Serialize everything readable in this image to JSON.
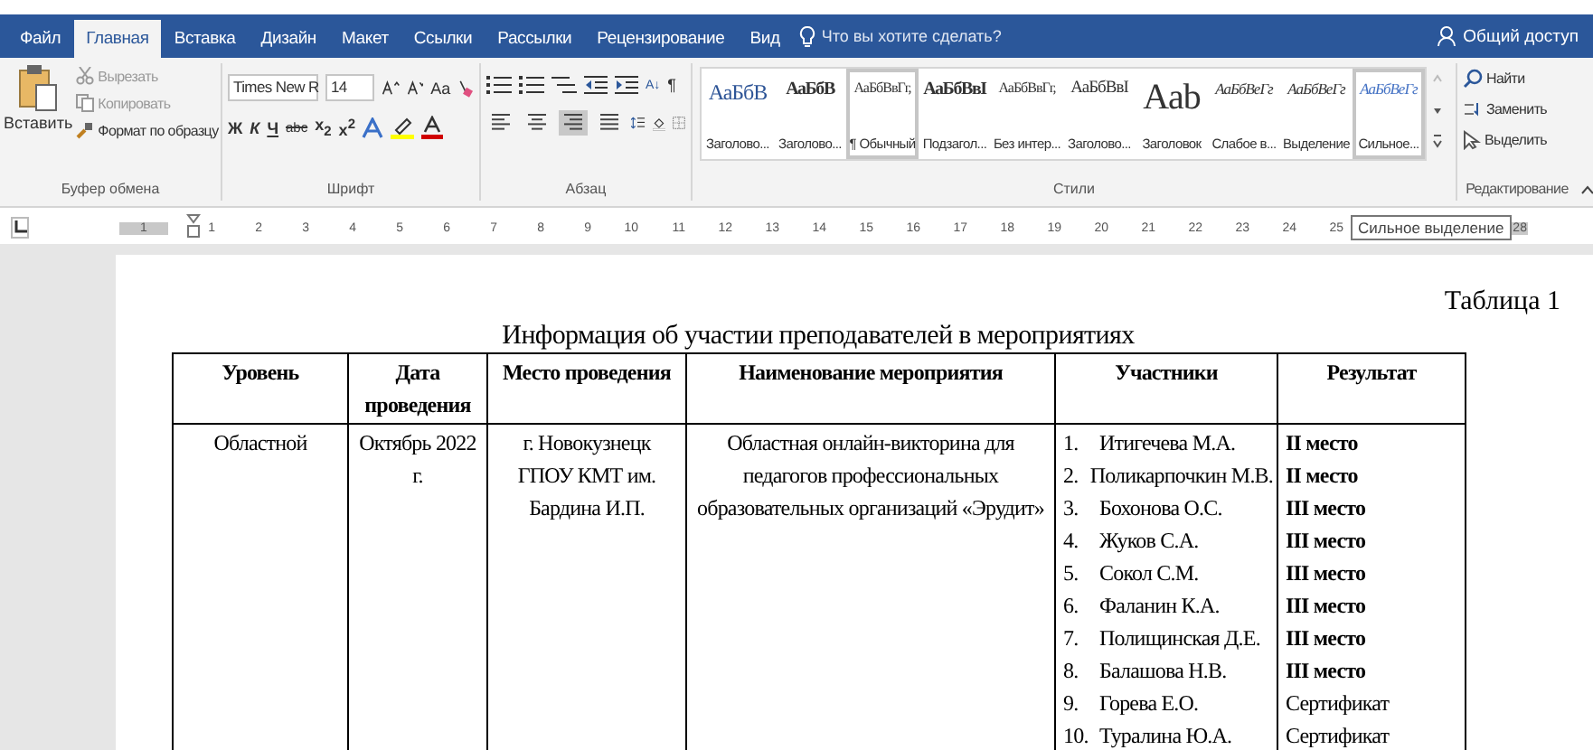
{
  "tabs": [
    {
      "label": "Файл",
      "selected": false
    },
    {
      "label": "Главная",
      "selected": true
    },
    {
      "label": "Вставка",
      "selected": false
    },
    {
      "label": "Дизайн",
      "selected": false
    },
    {
      "label": "Макет",
      "selected": false
    },
    {
      "label": "Ссылки",
      "selected": false
    },
    {
      "label": "Рассылки",
      "selected": false
    },
    {
      "label": "Рецензирование",
      "selected": false
    },
    {
      "label": "Вид",
      "selected": false
    }
  ],
  "tell_me": "Что вы хотите сделать?",
  "share": "Общий доступ",
  "clipboard": {
    "paste": "Вставить",
    "cut": "Вырезать",
    "copy": "Копировать",
    "format_painter": "Формат по образцу",
    "group": "Буфер обмена"
  },
  "font": {
    "name": "Times New R",
    "size": "14",
    "case": "Aa",
    "bold": "Ж",
    "italic": "К",
    "underline": "Ч",
    "strike": "abc",
    "subscript": "x$_{2}$",
    "superscript": "x$^{2}$",
    "group": "Шрифт"
  },
  "paragraph": {
    "group": "Абзац",
    "sort": "А↓",
    "pilcrow": "¶",
    "alignments": [
      {
        "kind": "left",
        "selected": false
      },
      {
        "kind": "center",
        "selected": false
      },
      {
        "kind": "right",
        "selected": true
      },
      {
        "kind": "justify",
        "selected": false
      }
    ]
  },
  "styles": {
    "group": "Стили",
    "items": [
      {
        "preview": "АаБбВ",
        "label": "Заголово...",
        "kind": "heading",
        "selected": false
      },
      {
        "preview": "АаБбВ",
        "label": "Заголово...",
        "kind": "strong",
        "selected": false
      },
      {
        "preview": "АаБбВвГг,",
        "label": "¶ Обычный",
        "kind": "normal",
        "selected": true
      },
      {
        "preview": "АаБбВвІ",
        "label": "Подзагол...",
        "kind": "strong",
        "selected": false
      },
      {
        "preview": "АаБбВвГг,",
        "label": "Без интер...",
        "kind": "normal",
        "selected": false
      },
      {
        "preview": "АаБбВвІ",
        "label": "Заголово...",
        "kind": "serif",
        "selected": false
      },
      {
        "preview": "Aab",
        "label": "Заголовок",
        "kind": "title",
        "selected": false
      },
      {
        "preview": "АаБбВеГг",
        "label": "Слабое в...",
        "kind": "italic",
        "selected": false
      },
      {
        "preview": "АаБбВеГг",
        "label": "Выделение",
        "kind": "italic",
        "selected": false
      },
      {
        "preview": "АаБбВеГг",
        "label": "Сильное...",
        "kind": "accent",
        "selected": true
      }
    ]
  },
  "editing": {
    "find": "Найти",
    "replace": "Заменить",
    "select": "Выделить",
    "group": "Редактирование"
  },
  "ruler": {
    "marks": [
      "1",
      "1",
      "2",
      "3",
      "4",
      "5",
      "6",
      "7",
      "8",
      "9",
      "10",
      "11",
      "12",
      "13",
      "14",
      "15",
      "16",
      "17",
      "18",
      "19",
      "20",
      "21",
      "22",
      "23",
      "24",
      "25"
    ],
    "tooltip": "Сильное выделение",
    "end_mark": "28"
  },
  "document": {
    "caption": "Таблица 1",
    "title": "Информация об участии преподавателей в мероприятиях",
    "columns": [
      "Уровень",
      "Дата проведения",
      "Место проведения",
      "Наименование мероприятия",
      "Участники",
      "Результат"
    ],
    "rows": [
      {
        "level": "Областной",
        "date": "Октябрь 2022 г.",
        "place": "г. Новокузнецк ГПОУ КМТ им. Бардина И.П.",
        "event": "Областная онлайн-викторина для педагогов профессиональных образовательных организаций «Эрудит»",
        "participants": [
          {
            "number": "1.",
            "name": "Итигечева М.А."
          },
          {
            "number": "2.",
            "name": "Поликарпочкин М.В."
          },
          {
            "number": "3.",
            "name": "Бохонова О.С."
          },
          {
            "number": "4.",
            "name": "Жуков С.А."
          },
          {
            "number": "5.",
            "name": "Сокол С.М."
          },
          {
            "number": "6.",
            "name": "Фаланин К.А."
          },
          {
            "number": "7.",
            "name": "Полищинская Д.Е."
          },
          {
            "number": "8.",
            "name": "Балашова Н.В."
          },
          {
            "number": "9.",
            "name": "Горева Е.О."
          },
          {
            "number": "10.",
            "name": "Туралина Ю.А."
          }
        ],
        "results": [
          {
            "text": "II место",
            "bold": true
          },
          {
            "text": "II место",
            "bold": true
          },
          {
            "text": "III место",
            "bold": true
          },
          {
            "text": "III место",
            "bold": true
          },
          {
            "text": "III место",
            "bold": true
          },
          {
            "text": "III место",
            "bold": true
          },
          {
            "text": "III место",
            "bold": true
          },
          {
            "text": "III место",
            "bold": true
          },
          {
            "text": "Сертификат",
            "bold": false
          },
          {
            "text": "Сертификат",
            "bold": false
          }
        ]
      }
    ]
  }
}
